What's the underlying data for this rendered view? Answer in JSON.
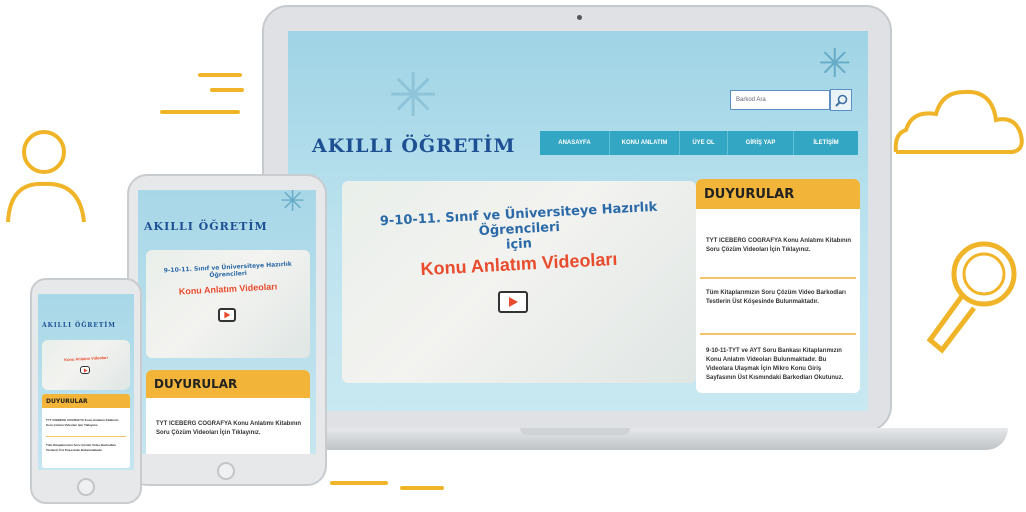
{
  "site": {
    "logo": "AKILLI ÖĞRETİM",
    "search_placeholder": "Barkod Ara",
    "nav": [
      "ANASAYFA",
      "KONU ANLATIM",
      "ÜYE OL",
      "GİRİŞ YAP",
      "İLETİŞİM"
    ]
  },
  "hero": {
    "line1": "9-10-11. Sınıf ve Üniversiteye Hazırlık Öğrencileri",
    "line2": "için",
    "line3": "Konu Anlatım Videoları"
  },
  "announcements": {
    "title": "DUYURULAR",
    "items": [
      {
        "text": "TYT ICEBERG COGRAFYA Konu Anlatımı Kitabının Soru Çözüm Videoları İçin ",
        "link": "Tıklayınız."
      },
      {
        "text": "Tüm Kitaplarımızın Soru Çözüm Video Barkodları Testlerin Üst Köşesinde Bulunmaktadır.",
        "link": ""
      },
      {
        "text": "9-10-11-TYT ve AYT Soru Bankası Kitaplarımızın Konu Anlatım Videoları Bulunmaktadır. Bu Videolara Ulaşmak İçin Mikro Konu Giriş Sayfasının Üst Kısmındaki Barkodları Okutunuz.",
        "link": ""
      }
    ]
  },
  "colors": {
    "accent": "#f2b539",
    "nav": "#33a6c4",
    "logo": "#1d4f92",
    "hero_highlight": "#e94b2d",
    "deco": "#f0b429"
  },
  "icons": [
    "user-icon",
    "cloud-icon",
    "magnifier-icon",
    "play-icon",
    "search-icon"
  ]
}
